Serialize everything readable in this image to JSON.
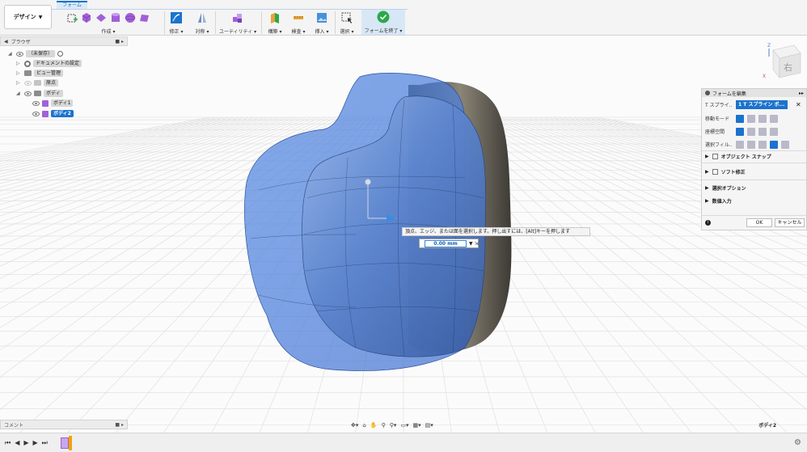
{
  "toolbar": {
    "design_label": "デザイン",
    "active_tab": "フォーム",
    "groups": {
      "create": "作成 ▾",
      "modify": "修正 ▾",
      "symmetry": "対称 ▾",
      "utility": "ユーティリティ ▾",
      "construct": "構築 ▾",
      "inspect": "検査 ▾",
      "insert": "挿入 ▾",
      "select": "選択 ▾",
      "finish": "フォームを終了 ▾"
    }
  },
  "browser": {
    "title": "ブラウザ",
    "root": "（未保存）",
    "items": [
      {
        "label": "ドキュメントの設定"
      },
      {
        "label": "ビュー管理"
      },
      {
        "label": "原点"
      },
      {
        "label": "ボディ"
      },
      {
        "label": "ボディ1"
      },
      {
        "label": "ボディ2"
      }
    ]
  },
  "view_cube": {
    "face": "右",
    "axis_z": "Z",
    "axis_x": "X"
  },
  "edit_panel": {
    "title": "フォームを編集",
    "spline_label": "T スプライ...",
    "spline_value": "1 T スプライン ボ...",
    "move_mode_label": "移動モード",
    "coord_space_label": "座標空間",
    "select_filter_label": "選択フィル...",
    "object_snap_label": "オブジェクト スナップ",
    "soft_modify_label": "ソフト修正",
    "select_options_label": "選択オプション",
    "numeric_input_label": "数値入力",
    "ok_label": "OK",
    "cancel_label": "キャンセル"
  },
  "tooltip": {
    "text": "頂点、エッジ、または面を選択します。押し出すには、[Alt]キーを押します"
  },
  "distance": {
    "value": "0.00 mm"
  },
  "comment": {
    "title": "コメント"
  },
  "status": {
    "body_name": "ボディ2"
  },
  "colors": {
    "accent": "#1b73ce",
    "body_blue": "#4a78c4",
    "body_gray": "#5a5650",
    "grid": "#d9d9d9",
    "finish_check": "#2ca84a"
  }
}
